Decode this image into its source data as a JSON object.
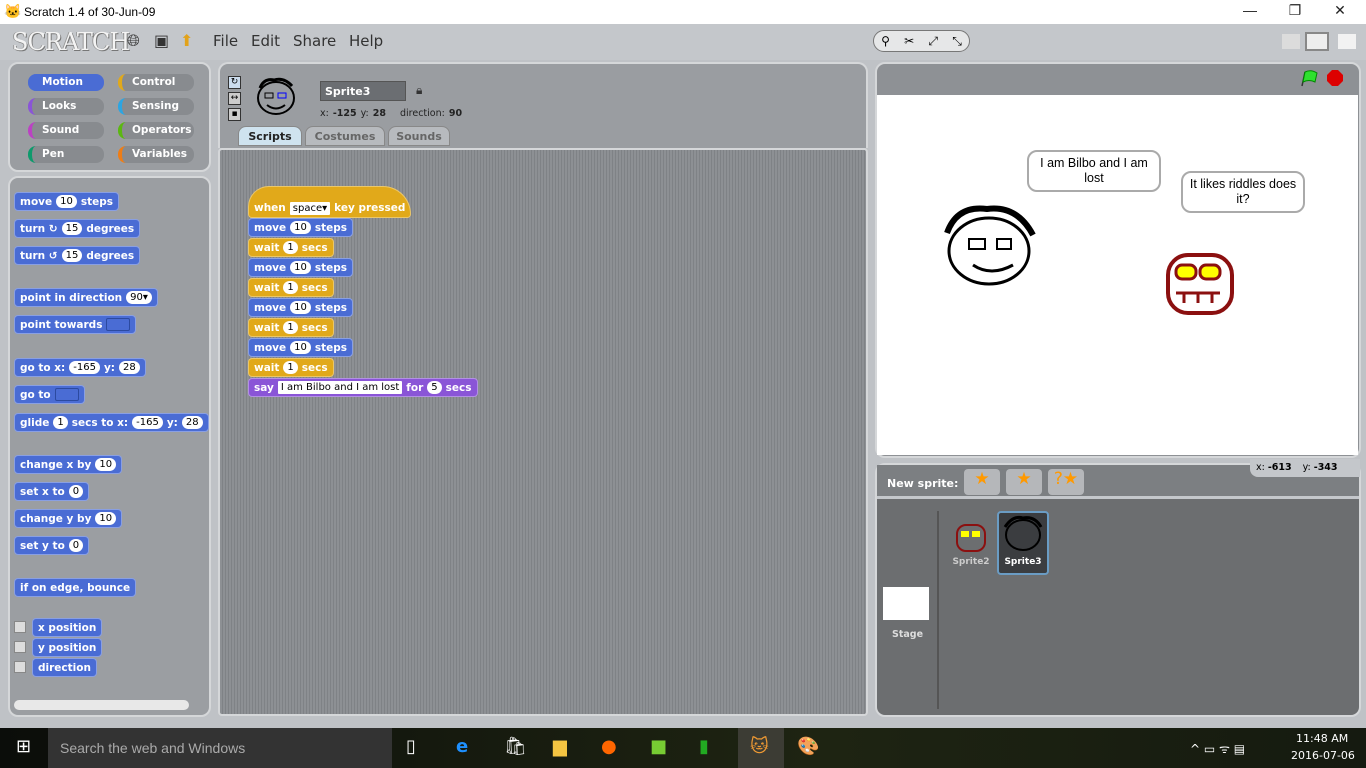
{
  "window": {
    "title": "Scratch 1.4 of 30-Jun-09",
    "min": "—",
    "max": "❐",
    "close": "✕"
  },
  "menubar": {
    "logo": "SCRATCH",
    "items": [
      "File",
      "Edit",
      "Share",
      "Help"
    ]
  },
  "categories": [
    {
      "label": "Motion",
      "color": "#4a6cd4",
      "active": true
    },
    {
      "label": "Control",
      "color": "#e1a91a"
    },
    {
      "label": "Looks",
      "color": "#8a55d7"
    },
    {
      "label": "Sensing",
      "color": "#2ca5e2"
    },
    {
      "label": "Sound",
      "color": "#bb42c3"
    },
    {
      "label": "Operators",
      "color": "#5cb712"
    },
    {
      "label": "Pen",
      "color": "#0e9a6c"
    },
    {
      "label": "Variables",
      "color": "#ee7d16"
    }
  ],
  "palette": [
    {
      "parts": [
        [
          "t",
          "move"
        ],
        [
          "i",
          "10"
        ],
        [
          "t",
          "steps"
        ]
      ]
    },
    {
      "parts": [
        [
          "t",
          "turn ↻"
        ],
        [
          "i",
          "15"
        ],
        [
          "t",
          "degrees"
        ]
      ]
    },
    {
      "parts": [
        [
          "t",
          "turn ↺"
        ],
        [
          "i",
          "15"
        ],
        [
          "t",
          "degrees"
        ]
      ]
    },
    {
      "parts": [
        [
          "t",
          "point in direction"
        ],
        [
          "i",
          "90▾"
        ]
      ]
    },
    {
      "parts": [
        [
          "t",
          "point towards"
        ],
        [
          "d",
          ""
        ]
      ]
    },
    {
      "parts": [
        [
          "t",
          "go to x:"
        ],
        [
          "i",
          "-165"
        ],
        [
          "t",
          "y:"
        ],
        [
          "i",
          "28"
        ]
      ]
    },
    {
      "parts": [
        [
          "t",
          "go to"
        ],
        [
          "d",
          ""
        ]
      ]
    },
    {
      "parts": [
        [
          "t",
          "glide"
        ],
        [
          "i",
          "1"
        ],
        [
          "t",
          "secs to x:"
        ],
        [
          "i",
          "-165"
        ],
        [
          "t",
          "y:"
        ],
        [
          "i",
          "28"
        ]
      ]
    },
    {
      "parts": [
        [
          "t",
          "change x by"
        ],
        [
          "i",
          "10"
        ]
      ]
    },
    {
      "parts": [
        [
          "t",
          "set x to"
        ],
        [
          "i",
          "0"
        ]
      ]
    },
    {
      "parts": [
        [
          "t",
          "change y by"
        ],
        [
          "i",
          "10"
        ]
      ]
    },
    {
      "parts": [
        [
          "t",
          "set y to"
        ],
        [
          "i",
          "0"
        ]
      ]
    },
    {
      "parts": [
        [
          "t",
          "if on edge, bounce"
        ]
      ]
    },
    {
      "parts": [
        [
          "t",
          "x position"
        ]
      ],
      "checkbox": true
    },
    {
      "parts": [
        [
          "t",
          "y position"
        ]
      ],
      "checkbox": true
    },
    {
      "parts": [
        [
          "t",
          "direction"
        ]
      ],
      "checkbox": true
    }
  ],
  "sprite": {
    "name": "Sprite3",
    "x_label": "x:",
    "x": "-125",
    "y_label": "y:",
    "y": "28",
    "direction_label": "direction:",
    "direction": "90"
  },
  "tabs": [
    "Scripts",
    "Costumes",
    "Sounds"
  ],
  "script": [
    {
      "cls": "control",
      "parts": [
        [
          "t",
          "when"
        ],
        [
          "s",
          "space▾"
        ],
        [
          "t",
          "key pressed"
        ]
      ],
      "hat": true
    },
    {
      "cls": "motion",
      "parts": [
        [
          "t",
          "move"
        ],
        [
          "i",
          "10"
        ],
        [
          "t",
          "steps"
        ]
      ]
    },
    {
      "cls": "control",
      "parts": [
        [
          "t",
          "wait"
        ],
        [
          "i",
          "1"
        ],
        [
          "t",
          "secs"
        ]
      ]
    },
    {
      "cls": "motion",
      "parts": [
        [
          "t",
          "move"
        ],
        [
          "i",
          "10"
        ],
        [
          "t",
          "steps"
        ]
      ]
    },
    {
      "cls": "control",
      "parts": [
        [
          "t",
          "wait"
        ],
        [
          "i",
          "1"
        ],
        [
          "t",
          "secs"
        ]
      ]
    },
    {
      "cls": "motion",
      "parts": [
        [
          "t",
          "move"
        ],
        [
          "i",
          "10"
        ],
        [
          "t",
          "steps"
        ]
      ]
    },
    {
      "cls": "control",
      "parts": [
        [
          "t",
          "wait"
        ],
        [
          "i",
          "1"
        ],
        [
          "t",
          "secs"
        ]
      ]
    },
    {
      "cls": "motion",
      "parts": [
        [
          "t",
          "move"
        ],
        [
          "i",
          "10"
        ],
        [
          "t",
          "steps"
        ]
      ]
    },
    {
      "cls": "control",
      "parts": [
        [
          "t",
          "wait"
        ],
        [
          "i",
          "1"
        ],
        [
          "t",
          "secs"
        ]
      ]
    },
    {
      "cls": "looks",
      "parts": [
        [
          "t",
          "say"
        ],
        [
          "s",
          "I am Bilbo and I am lost"
        ],
        [
          "t",
          "for"
        ],
        [
          "i",
          "5"
        ],
        [
          "t",
          "secs"
        ]
      ]
    }
  ],
  "stage": {
    "bubble1": "I am Bilbo and I am lost",
    "bubble2": "It likes riddles does it?"
  },
  "spritepane": {
    "new_sprite": "New sprite:",
    "mouse_x_label": "x:",
    "mouse_x": "-613",
    "mouse_y_label": "y:",
    "mouse_y": "-343",
    "stage_label": "Stage",
    "sprites": [
      "Sprite2",
      "Sprite3"
    ]
  },
  "taskbar": {
    "search": "Search the web and Windows",
    "time": "11:48 AM",
    "date": "2016-07-06"
  }
}
